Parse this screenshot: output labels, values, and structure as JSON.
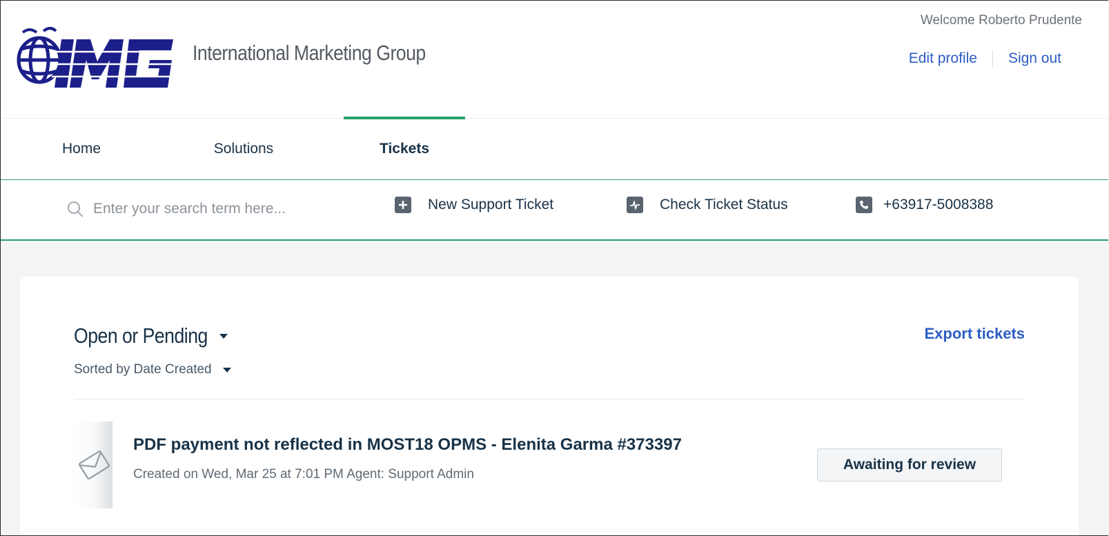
{
  "header": {
    "company_name": "International Marketing Group",
    "welcome_text": "Welcome Roberto Prudente",
    "edit_profile": "Edit profile",
    "sign_out": "Sign out",
    "accent_color": "#2aa071",
    "link_color": "#2c5cc5"
  },
  "nav": {
    "tabs": [
      {
        "label": "Home",
        "active": false
      },
      {
        "label": "Solutions",
        "active": false
      },
      {
        "label": "Tickets",
        "active": true
      }
    ]
  },
  "actions": {
    "search_placeholder": "Enter your search term here...",
    "new_ticket": "New Support Ticket",
    "check_status": "Check Ticket Status",
    "phone": "+63917-5008388"
  },
  "tickets": {
    "filter": "Open or Pending",
    "sort": "Sorted by Date Created",
    "export": "Export tickets",
    "items": [
      {
        "title": "PDF payment not reflected in MOST18 OPMS - Elenita Garma #373397",
        "meta": "Created on Wed, Mar 25 at 7:01 PM Agent: Support Admin",
        "status": "Awaiting for review"
      }
    ]
  }
}
